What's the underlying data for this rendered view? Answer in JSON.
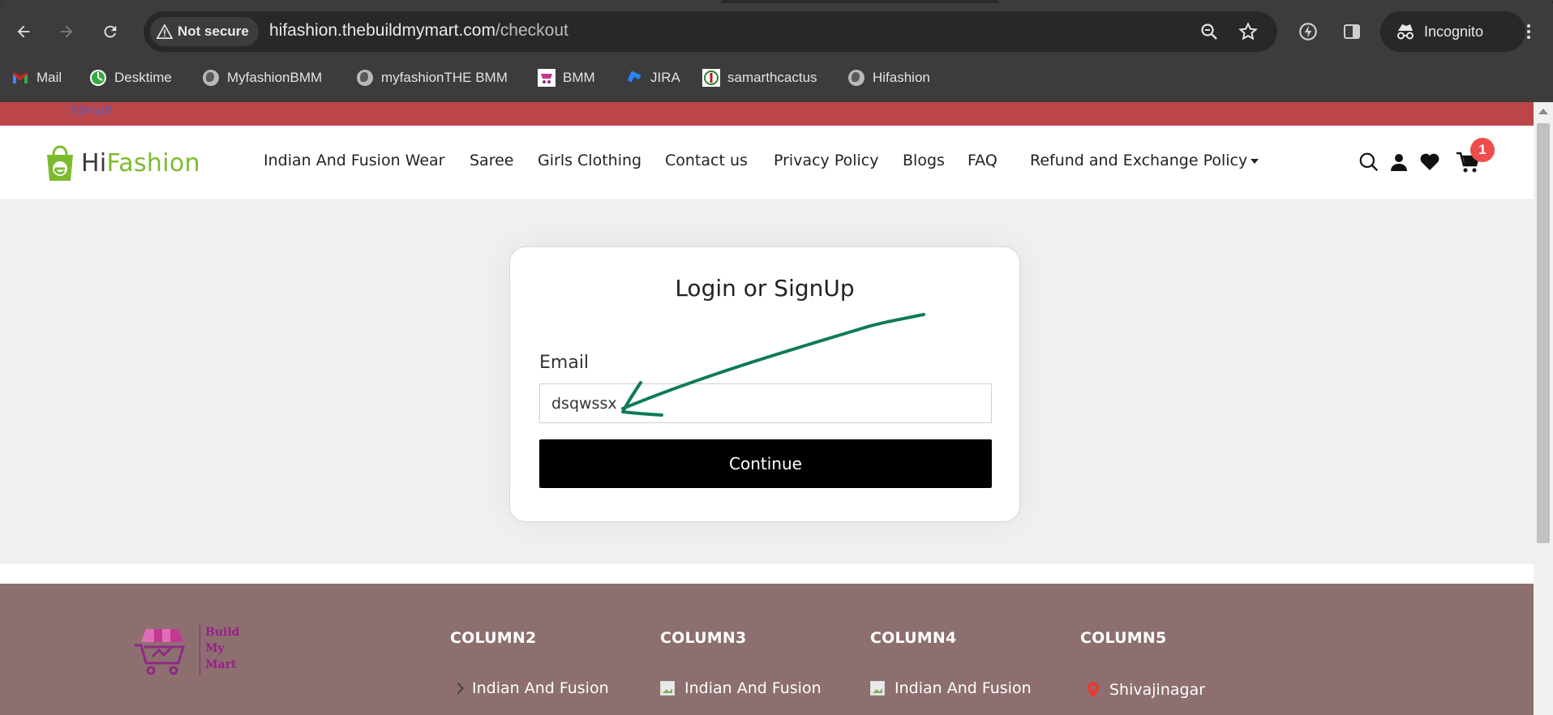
{
  "browser": {
    "security_label": "Not secure",
    "url_host": "hifashion.thebuildmymart.com",
    "url_path": "/checkout",
    "profile_label": "Incognito",
    "bookmarks": [
      {
        "label": "Mail",
        "icon": "gmail-icon"
      },
      {
        "label": "Desktime",
        "icon": "desktime-icon"
      },
      {
        "label": "MyfashionBMM",
        "icon": "globe-icon"
      },
      {
        "label": "myfashionTHE BMM",
        "icon": "globe-icon"
      },
      {
        "label": "BMM",
        "icon": "bmm-icon"
      },
      {
        "label": "JIRA",
        "icon": "jira-icon"
      },
      {
        "label": "samarthcactus",
        "icon": "cactus-icon"
      },
      {
        "label": "Hifashion",
        "icon": "globe-icon"
      }
    ]
  },
  "promo": {
    "text": "50%off"
  },
  "header": {
    "logo_hi": "Hi",
    "logo_fashion": "Fashion",
    "nav": [
      "Indian And Fusion Wear",
      "Saree",
      "Girls Clothing",
      "Contact us",
      "Privacy Policy",
      "Blogs",
      "FAQ",
      "Refund and Exchange Policy"
    ],
    "cart_count": "1"
  },
  "login": {
    "title": "Login or SignUp",
    "email_label": "Email",
    "email_value": "dsqwssx",
    "continue_label": "Continue"
  },
  "footer": {
    "logo_lines": [
      "Build",
      "My",
      "Mart"
    ],
    "columns": [
      {
        "heading": "COLUMN2",
        "first_item": "Indian And Fusion"
      },
      {
        "heading": "COLUMN3",
        "first_item": "Indian And Fusion"
      },
      {
        "heading": "COLUMN4",
        "first_item": "Indian And Fusion"
      },
      {
        "heading": "COLUMN5",
        "first_item": "Shivajinagar"
      }
    ]
  },
  "colors": {
    "promo_bar": "#bb4548",
    "brand_green": "#7dbb2e",
    "footer_bg": "#8d6f70",
    "cart_badge": "#ef4d4d",
    "annotation_arrow": "#0f7b55"
  }
}
